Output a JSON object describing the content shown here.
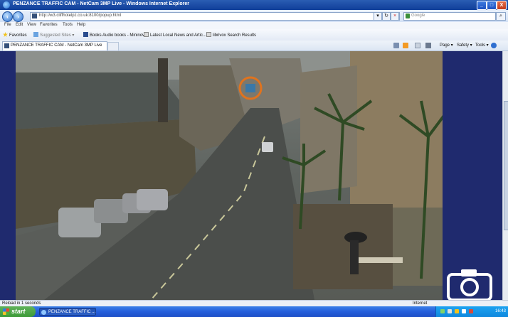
{
  "window": {
    "title": "PENZANCE TRAFFIC CAM - NetCam 3MP Live - Windows Internet Explorer",
    "minimize_label": "_",
    "maximize_label": "□",
    "close_label": "X"
  },
  "address_bar": {
    "url": "http://w3.cliffhotelpz.co.uk:8100/popup.html",
    "search_placeholder": "Google"
  },
  "menu": [
    "File",
    "Edit",
    "View",
    "Favorites",
    "Tools",
    "Help"
  ],
  "favorites_bar": {
    "favorites_label": "Favorites",
    "items": [
      "Suggested Sites ▾",
      "Books Audio books - Mininova",
      "Latest Local News and Artic...",
      "librivox Search Results"
    ]
  },
  "tabs": {
    "active_label": "PENZANCE TRAFFIC CAM - NetCam 3MP Live"
  },
  "command_bar": {
    "page": "Page ▾",
    "safety": "Safety ▾",
    "tools": "Tools ▾"
  },
  "status_bar": {
    "status": "Reload in 1 seconds",
    "zone": "Internet"
  },
  "taskbar": {
    "start": "start",
    "task_label": "PENZANCE TRAFFIC ...",
    "clock": "16:43"
  },
  "colors": {
    "page_background": "#1f2a6e",
    "highlight_circle": "#e0731e"
  }
}
